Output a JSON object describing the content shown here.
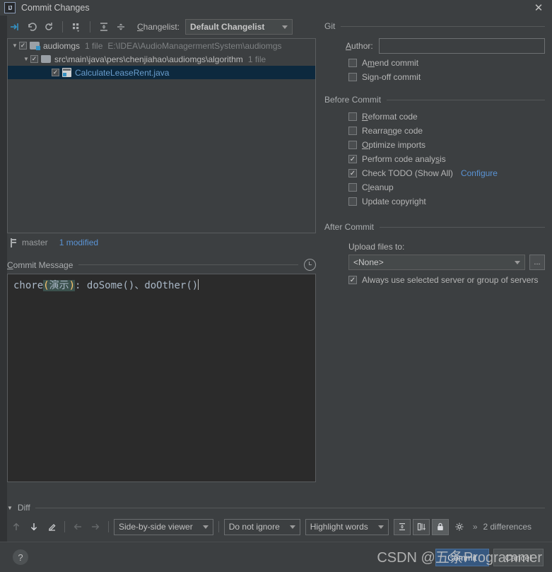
{
  "window": {
    "title": "Commit Changes",
    "logo_text": "IJ",
    "close_label": "✕"
  },
  "toolbar": {
    "icons": [
      {
        "name": "show-diff-icon",
        "tip": "Show Diff"
      },
      {
        "name": "revert-icon",
        "tip": "Revert"
      },
      {
        "name": "refresh-icon",
        "tip": "Refresh"
      },
      {
        "name": "group-by-icon",
        "tip": "Group By"
      },
      {
        "name": "expand-all-icon",
        "tip": "Expand All"
      },
      {
        "name": "collapse-all-icon",
        "tip": "Collapse All"
      }
    ],
    "changelist_label": "Changelist:",
    "changelist_mnemonic": "C",
    "changelist_value": "Default Changelist"
  },
  "tree": {
    "rows": [
      {
        "indent": 0,
        "expander": "▼",
        "checked": true,
        "icon": "folder-module-icon",
        "name": "audiomgs",
        "count": "1 file",
        "path": "E:\\IDEA\\AudioManagermentSystem\\audiomgs",
        "selected": false,
        "blue": false
      },
      {
        "indent": 1,
        "expander": "▼",
        "checked": true,
        "icon": "folder-icon",
        "name": "src\\main\\java\\pers\\chenjiahao\\audiomgs\\algorithm",
        "count": "1 file",
        "path": "",
        "selected": false,
        "blue": false
      },
      {
        "indent": 2,
        "expander": "",
        "checked": true,
        "icon": "java-file-icon",
        "name": "CalculateLeaseRent.java",
        "count": "",
        "path": "",
        "selected": true,
        "blue": true
      }
    ]
  },
  "status": {
    "branch": "master",
    "modified": "1 modified"
  },
  "commit_message": {
    "section_label": "Commit Message",
    "section_mnemonic": "C",
    "history_icon": "clock-icon",
    "prefix": "chore",
    "open_paren": "(",
    "scope": "演示",
    "close_paren": ")",
    "suffix": ": doSome()、doOther()",
    "full_text": "chore(演示): doSome()、doOther()"
  },
  "git_section": {
    "label": "Git",
    "author_label": "Author:",
    "author_mnemonic": "A",
    "author_value": "",
    "checkboxes": [
      {
        "label_pre": "A",
        "label_mn": "m",
        "label_post": "end commit",
        "full": "Amend commit",
        "checked": false,
        "name": "amend-commit"
      },
      {
        "label_pre": "Si",
        "label_mn": "g",
        "label_post": "n-off commit",
        "full": "Sign-off commit",
        "checked": false,
        "name": "sign-off-commit"
      }
    ]
  },
  "before_commit": {
    "label": "Before Commit",
    "checkboxes": [
      {
        "label_pre": "",
        "label_mn": "R",
        "label_post": "eformat code",
        "full": "Reformat code",
        "checked": false,
        "name": "reformat-code"
      },
      {
        "label_pre": "Rearra",
        "label_mn": "n",
        "label_post": "ge code",
        "full": "Rearrange code",
        "checked": false,
        "name": "rearrange-code"
      },
      {
        "label_pre": "",
        "label_mn": "O",
        "label_post": "ptimize imports",
        "full": "Optimize imports",
        "checked": false,
        "name": "optimize-imports"
      },
      {
        "label_pre": "Perform code analy",
        "label_mn": "s",
        "label_post": "is",
        "full": "Perform code analysis",
        "checked": true,
        "name": "perform-code-analysis"
      },
      {
        "label_pre": "Check TODO (Show All)",
        "label_mn": "",
        "label_post": "",
        "full": "Check TODO (Show All)",
        "checked": true,
        "name": "check-todo",
        "link": "Configure"
      },
      {
        "label_pre": "C",
        "label_mn": "l",
        "label_post": "eanup",
        "full": "Cleanup",
        "checked": false,
        "name": "cleanup"
      },
      {
        "label_pre": "Update copyright",
        "label_mn": "",
        "label_post": "",
        "full": "Update copyright",
        "checked": false,
        "name": "update-copyright"
      }
    ]
  },
  "after_commit": {
    "label": "After Commit",
    "upload_label": "Upload files to:",
    "upload_value": "<None>",
    "ellipsis_label": "...",
    "always_use": {
      "full": "Always use selected server or group of servers",
      "checked": true
    }
  },
  "diff": {
    "label": "Diff",
    "expander": "▼",
    "icons": [
      {
        "name": "previous-difference-icon",
        "dim": true,
        "glyph": "↑"
      },
      {
        "name": "next-difference-icon",
        "dim": false,
        "glyph": "↓"
      },
      {
        "name": "edit-source-icon",
        "dim": false,
        "glyph": "pencil"
      },
      {
        "name": "apply-left-icon",
        "dim": true,
        "glyph": "←"
      },
      {
        "name": "apply-right-icon",
        "dim": true,
        "glyph": "→"
      }
    ],
    "viewer_mode": "Side-by-side viewer",
    "whitespace_mode": "Do not ignore",
    "highlight_mode": "Highlight words",
    "toggle_icons": [
      {
        "name": "collapse-unchanged-icon",
        "active": false
      },
      {
        "name": "show-diff-preview-icon",
        "active": false
      },
      {
        "name": "synchronize-scroll-icon",
        "active": true
      },
      {
        "name": "diff-settings-gear-icon",
        "active": false
      }
    ],
    "overflow_label": "»",
    "differences": "2 differences"
  },
  "footer": {
    "help_label": "?",
    "buttons": [
      {
        "label": "Commit",
        "primary": true,
        "name": "commit-button"
      },
      {
        "label": "Cancel",
        "primary": false,
        "name": "cancel-button"
      }
    ]
  },
  "watermark": {
    "text": "CSDN @五条Programmer"
  }
}
